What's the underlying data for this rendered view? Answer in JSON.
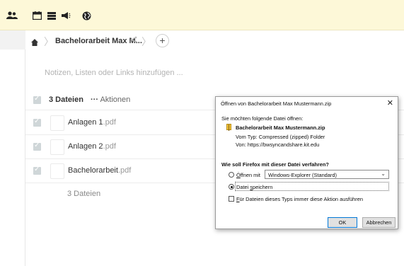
{
  "topbar": {
    "icons": [
      "users-icon",
      "calendar-icon",
      "stack-icon",
      "megaphone-icon",
      "globe-icon"
    ]
  },
  "breadcrumb": {
    "folder": "Bachelorarbeit Max M...",
    "add": "+"
  },
  "notes_placeholder": "Notizen, Listen oder Links hinzufügen ...",
  "list": {
    "count": "3 Dateien",
    "actions_dots": "···",
    "actions": "Aktionen",
    "files": [
      {
        "base": "Anlagen 1",
        "ext": ".pdf"
      },
      {
        "base": "Anlagen 2",
        "ext": ".pdf"
      },
      {
        "base": "Bachelorarbeit",
        "ext": ".pdf"
      }
    ],
    "footer": "3 Dateien"
  },
  "dialog": {
    "title": "Öffnen von Bachelorarbeit Max Mustermann.zip",
    "close": "✕",
    "question": "Sie möchten folgende Datei öffnen:",
    "filename": "Bachelorarbeit Max Mustermann.zip",
    "type_line": "Vom Typ:  Compressed (zipped) Folder",
    "from_line": "Von:  https://bwsyncandshare.kit.edu",
    "how": "Wie soll Firefox mit dieser Datei verfahren?",
    "open_with_prefix": "Ö",
    "open_with_rest": "ffnen mit",
    "open_with_app": "Windows-Explorer (Standard)",
    "save_prefix": "Datei ",
    "save_key": "s",
    "save_rest": "peichern",
    "always_key": "F",
    "always_rest": "ür Dateien dieses Typs immer diese Aktion ausführen",
    "ok": "OK",
    "cancel": "Abbrechen"
  },
  "colors": {
    "topbar_bg": "#fdf8d8",
    "checkbox": "#cfd6d8",
    "ok_border": "#0078d7"
  }
}
